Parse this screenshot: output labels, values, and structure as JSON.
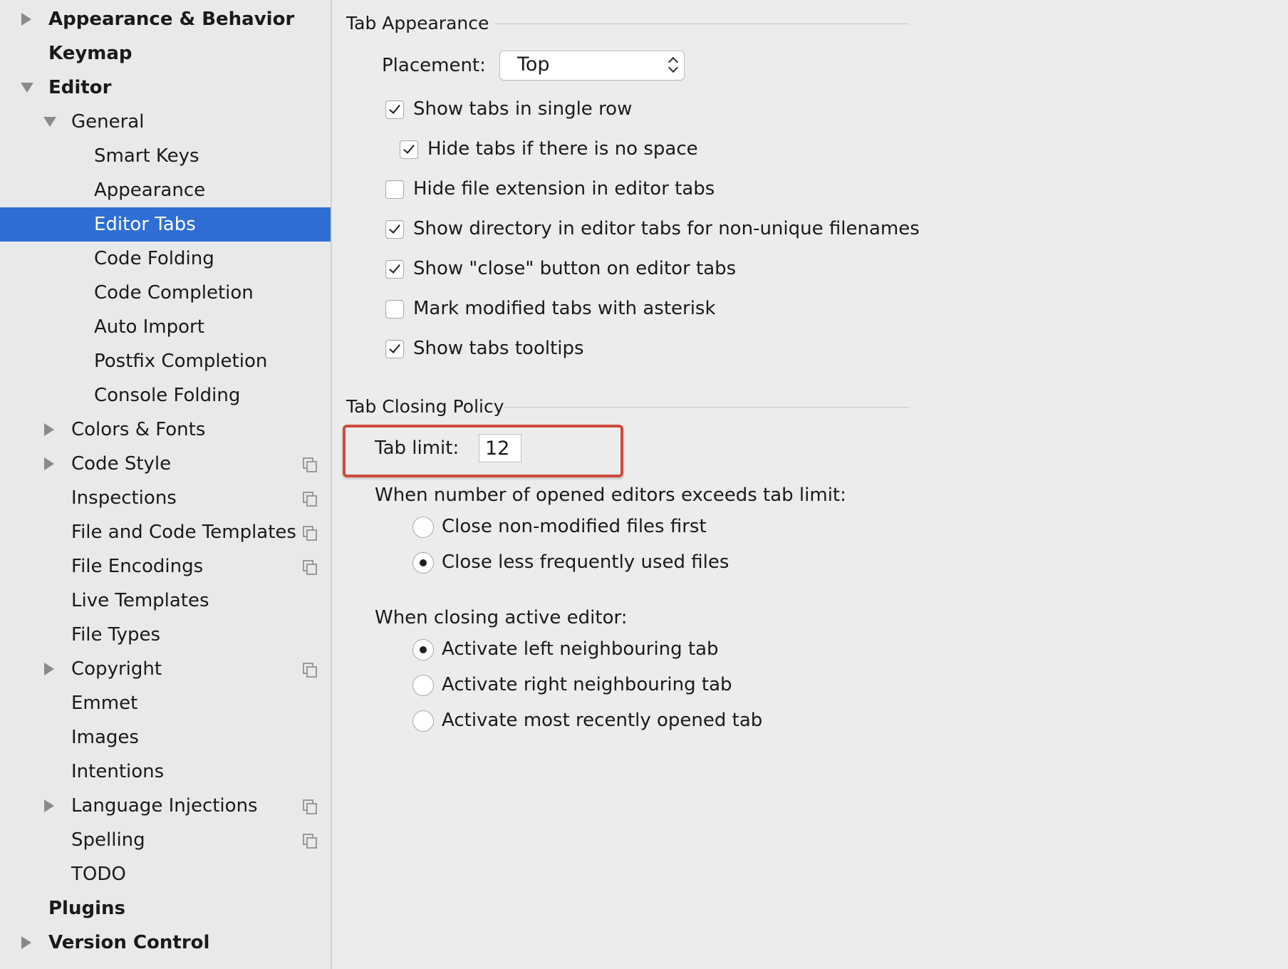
{
  "sidebar": {
    "items": [
      {
        "label": "Appearance & Behavior",
        "expander": "collapsed",
        "bold": true
      },
      {
        "label": "Keymap",
        "expander": "none",
        "bold": true
      },
      {
        "label": "Editor",
        "expander": "expanded",
        "bold": true
      },
      {
        "label": "General",
        "expander": "expanded"
      },
      {
        "label": "Smart Keys"
      },
      {
        "label": "Appearance"
      },
      {
        "label": "Editor Tabs",
        "selected": true
      },
      {
        "label": "Code Folding"
      },
      {
        "label": "Code Completion"
      },
      {
        "label": "Auto Import"
      },
      {
        "label": "Postfix Completion"
      },
      {
        "label": "Console Folding"
      },
      {
        "label": "Colors & Fonts",
        "expander": "collapsed"
      },
      {
        "label": "Code Style",
        "expander": "collapsed",
        "project_icon": true
      },
      {
        "label": "Inspections",
        "project_icon": true
      },
      {
        "label": "File and Code Templates",
        "project_icon": true
      },
      {
        "label": "File Encodings",
        "project_icon": true
      },
      {
        "label": "Live Templates"
      },
      {
        "label": "File Types"
      },
      {
        "label": "Copyright",
        "expander": "collapsed",
        "project_icon": true
      },
      {
        "label": "Emmet"
      },
      {
        "label": "Images"
      },
      {
        "label": "Intentions"
      },
      {
        "label": "Language Injections",
        "expander": "collapsed",
        "project_icon": true
      },
      {
        "label": "Spelling",
        "project_icon": true
      },
      {
        "label": "TODO"
      },
      {
        "label": "Plugins",
        "bold": true
      },
      {
        "label": "Version Control",
        "expander": "collapsed",
        "bold": true
      }
    ]
  },
  "tab_appearance": {
    "title": "Tab Appearance",
    "placement_label": "Placement:",
    "placement_value": "Top",
    "options": [
      {
        "label": "Show tabs in single row",
        "checked": true
      },
      {
        "label": "Hide tabs if there is no space",
        "checked": true
      },
      {
        "label": "Hide file extension in editor tabs",
        "checked": false
      },
      {
        "label": "Show directory in editor tabs for non-unique filenames",
        "checked": true
      },
      {
        "label": "Show \"close\" button on editor tabs",
        "checked": true
      },
      {
        "label": "Mark modified tabs with asterisk",
        "checked": false
      },
      {
        "label": "Show tabs tooltips",
        "checked": true
      }
    ]
  },
  "tab_closing": {
    "title": "Tab Closing Policy",
    "tab_limit_label": "Tab limit:",
    "tab_limit_value": "12",
    "exceed_label": "When number of opened editors exceeds tab limit:",
    "exceed_options": [
      {
        "label": "Close non-modified files first",
        "selected": false
      },
      {
        "label": "Close less frequently used files",
        "selected": true
      }
    ],
    "closing_label": "When closing active editor:",
    "closing_options": [
      {
        "label": "Activate left neighbouring tab",
        "selected": true
      },
      {
        "label": "Activate right neighbouring tab",
        "selected": false
      },
      {
        "label": "Activate most recently opened tab",
        "selected": false
      }
    ]
  },
  "colors": {
    "selection": "#2f6ed4",
    "highlight_border": "#d04a3b"
  }
}
